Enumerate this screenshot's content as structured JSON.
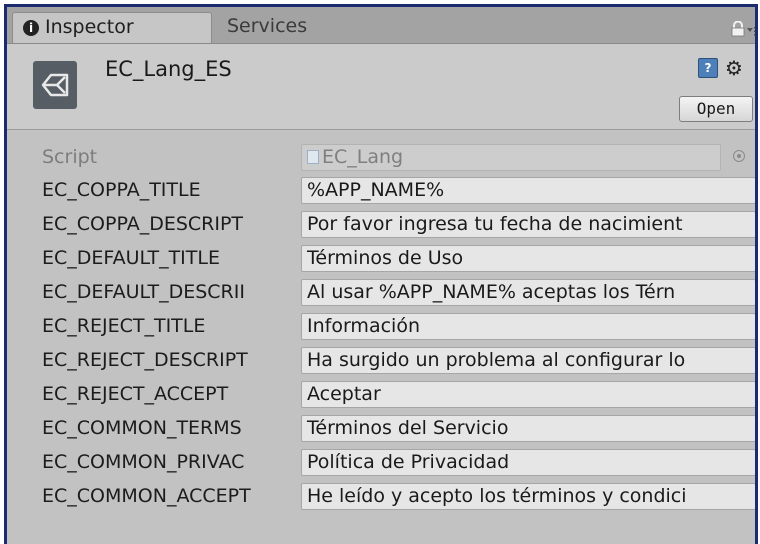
{
  "tabs": [
    {
      "label": "Inspector",
      "active": true
    },
    {
      "label": "Services",
      "active": false
    }
  ],
  "header": {
    "object_name": "EC_Lang_ES",
    "help_glyph": "?",
    "open_label": "Open"
  },
  "script_row": {
    "label": "Script",
    "value": "EC_Lang"
  },
  "properties": [
    {
      "label": "EC_COPPA_TITLE",
      "value": "%APP_NAME%"
    },
    {
      "label": "EC_COPPA_DESCRIPT",
      "value": "Por favor ingresa tu fecha de nacimient"
    },
    {
      "label": "EC_DEFAULT_TITLE",
      "value": "Términos de Uso"
    },
    {
      "label": "EC_DEFAULT_DESCRII",
      "value": "Al usar %APP_NAME% aceptas los Térn"
    },
    {
      "label": "EC_REJECT_TITLE",
      "value": "Información"
    },
    {
      "label": "EC_REJECT_DESCRIPT",
      "value": "Ha surgido un problema al configurar lo"
    },
    {
      "label": "EC_REJECT_ACCEPT",
      "value": "Aceptar"
    },
    {
      "label": "EC_COMMON_TERMS",
      "value": "Términos del Servicio"
    },
    {
      "label": "EC_COMMON_PRIVAC",
      "value": "Política de Privacidad"
    },
    {
      "label": "EC_COMMON_ACCEPT",
      "value": "He leído y acepto los términos y condici"
    }
  ],
  "icons": {
    "tab_icon": "info-icon",
    "lock": "lock-icon",
    "menu": "context-menu-icon",
    "object": "unity-logo-icon",
    "help": "help-icon",
    "settings": "gear-icon",
    "script_file": "script-file-icon",
    "picker": "object-picker-icon"
  },
  "colors": {
    "panel_bg": "#c2c2c2",
    "frame_border": "#1c2a6e",
    "field_bg": "#e6e6e6"
  }
}
